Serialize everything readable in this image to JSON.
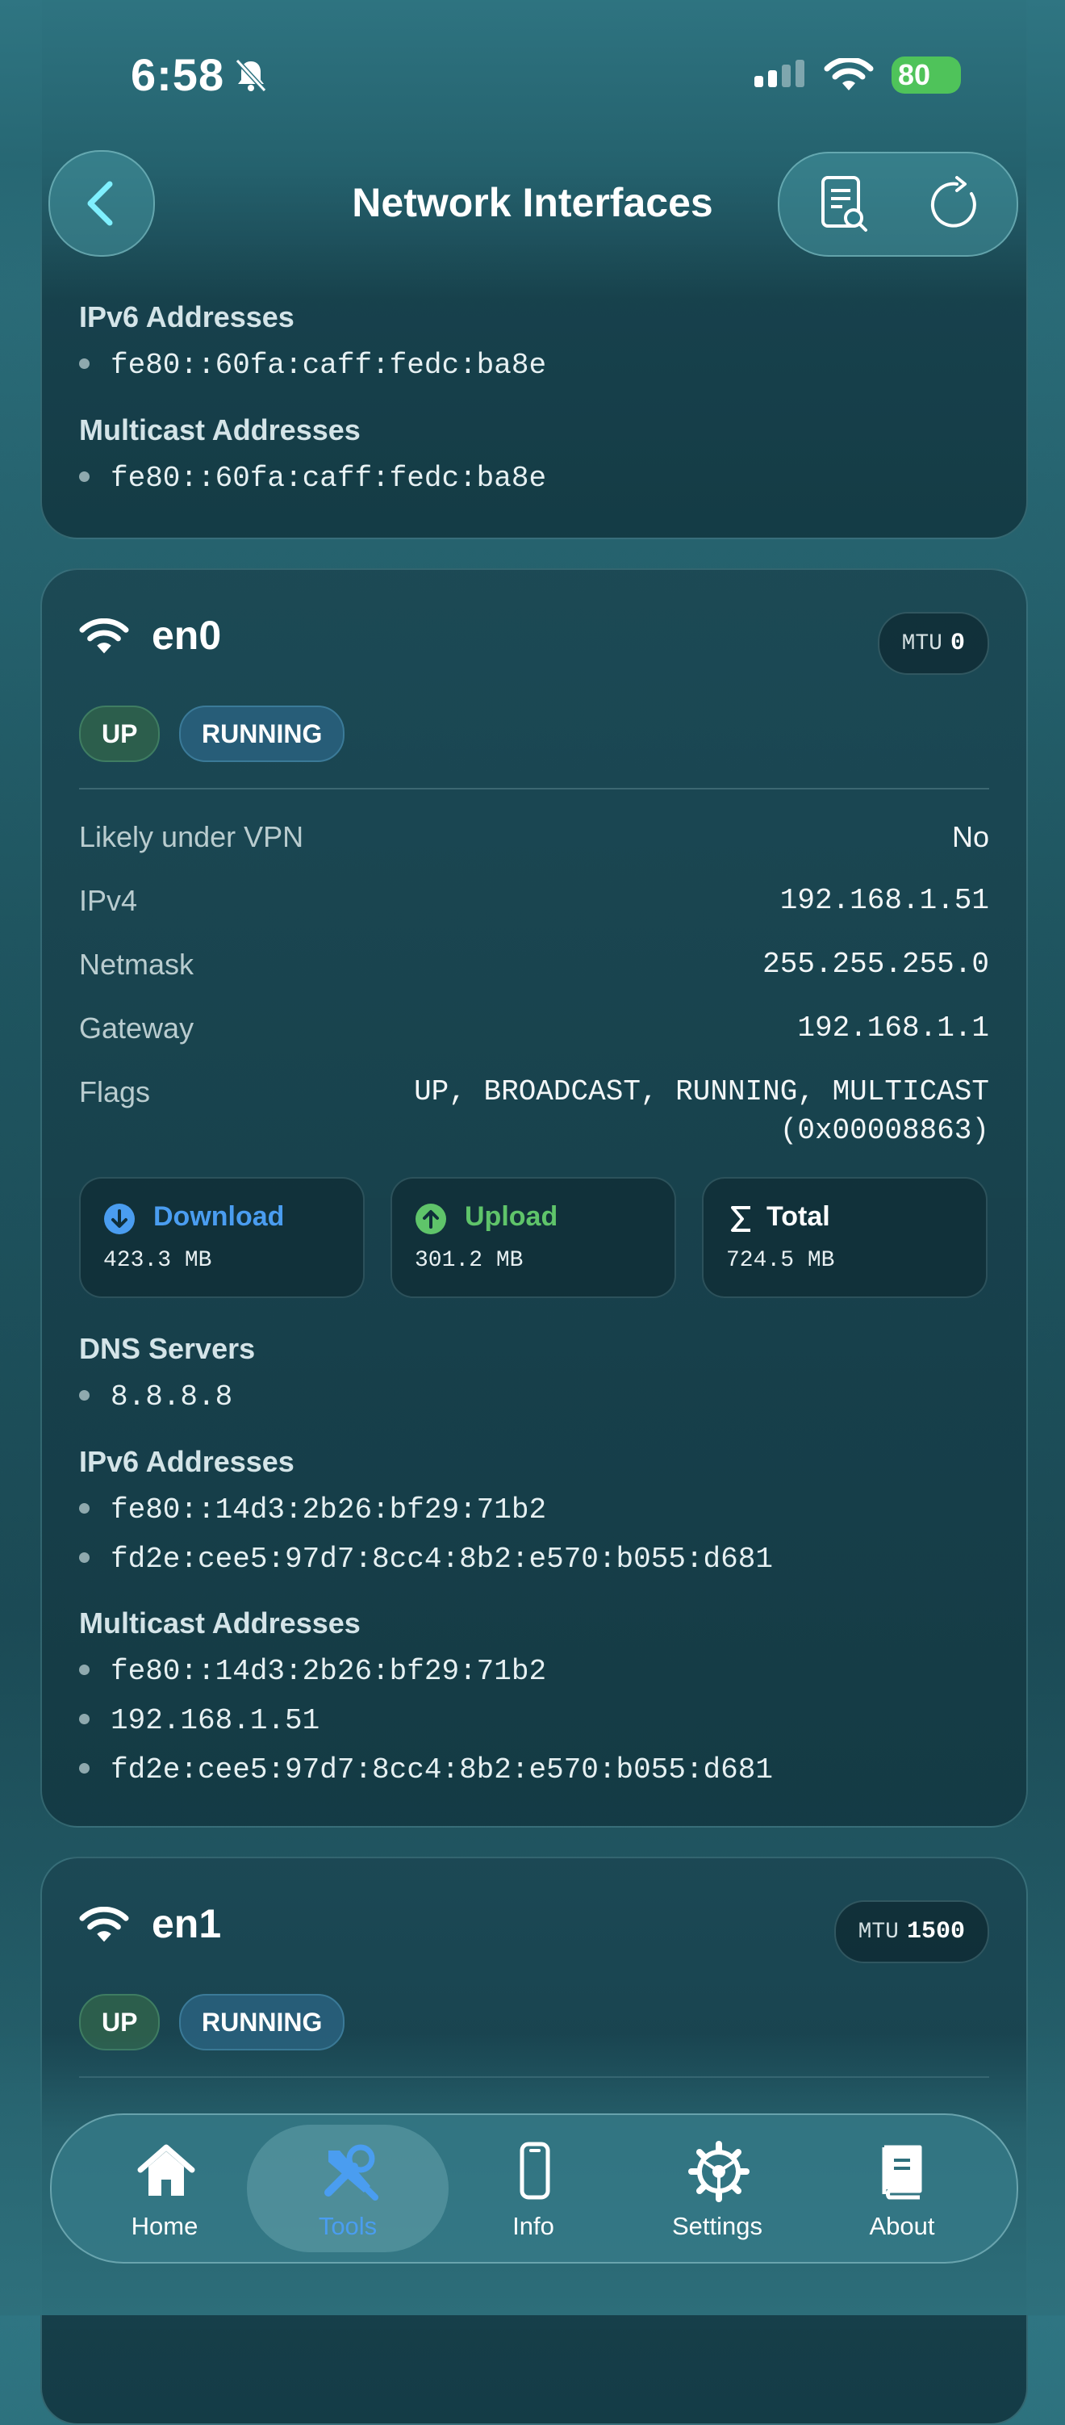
{
  "status": {
    "time": "6:58",
    "battery": "80"
  },
  "header": {
    "title": "Network Interfaces"
  },
  "card0": {
    "ipv6_title": "IPv6 Addresses",
    "ipv6": [
      "fe80::60fa:caff:fedc:ba8e"
    ],
    "multicast_title": "Multicast Addresses",
    "multicast": [
      "fe80::60fa:caff:fedc:ba8e"
    ]
  },
  "en0": {
    "name": "en0",
    "mtu_label": "MTU",
    "mtu_value": "0",
    "badges": [
      "UP",
      "RUNNING"
    ],
    "rows": [
      {
        "k": "Likely under VPN",
        "v": "No"
      },
      {
        "k": "IPv4",
        "v": "192.168.1.51"
      },
      {
        "k": "Netmask",
        "v": "255.255.255.0"
      },
      {
        "k": "Gateway",
        "v": "192.168.1.1"
      },
      {
        "k": "Flags",
        "v": "UP, BROADCAST, RUNNING, MULTICAST",
        "v2": "(0x00008863)"
      }
    ],
    "stats": [
      {
        "label": "Download",
        "value": "423.3 MB",
        "color": "#4a9df0"
      },
      {
        "label": "Upload",
        "value": "301.2 MB",
        "color": "#5fc46a"
      },
      {
        "label": "Total",
        "value": "724.5 MB",
        "color": "#ffffff"
      }
    ],
    "dns_title": "DNS Servers",
    "dns": [
      "8.8.8.8"
    ],
    "ipv6_title": "IPv6 Addresses",
    "ipv6": [
      "fe80::14d3:2b26:bf29:71b2",
      "fd2e:cee5:97d7:8cc4:8b2:e570:b055:d681"
    ],
    "multicast_title": "Multicast Addresses",
    "multicast": [
      "fe80::14d3:2b26:bf29:71b2",
      "192.168.1.51",
      "fd2e:cee5:97d7:8cc4:8b2:e570:b055:d681"
    ]
  },
  "en1": {
    "name": "en1",
    "mtu_label": "MTU",
    "mtu_value": "1500",
    "badges": [
      "UP",
      "RUNNING"
    ]
  },
  "tabs": [
    {
      "label": "Home",
      "icon": "home-icon"
    },
    {
      "label": "Tools",
      "icon": "tools-icon",
      "active": true
    },
    {
      "label": "Info",
      "icon": "phone-icon"
    },
    {
      "label": "Settings",
      "icon": "gear-icon"
    },
    {
      "label": "About",
      "icon": "book-icon"
    }
  ],
  "colors": {
    "accent_active_tab": "#4a9df0",
    "up_badge": "#2c5e4c",
    "running_badge": "#275d78"
  }
}
